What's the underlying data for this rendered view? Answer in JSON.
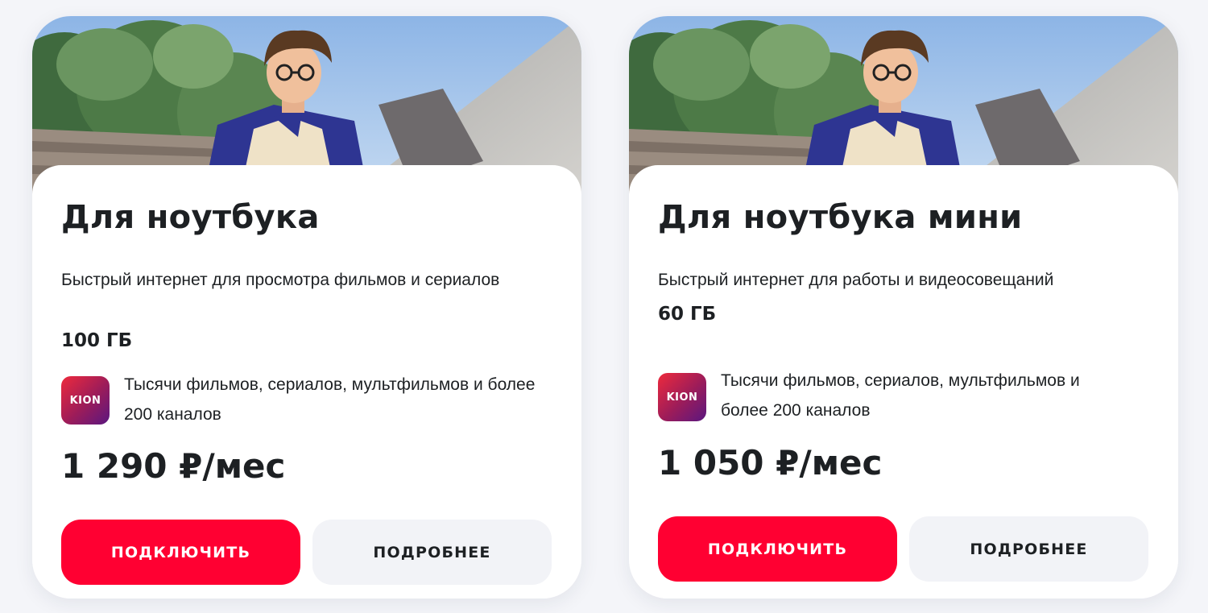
{
  "cards": [
    {
      "title": "Для ноутбука",
      "description": "Быстрый интернет для просмотра фильмов и сериалов",
      "data_amount": "100 ГБ",
      "kion_logo": "KION",
      "kion_text": "Тысячи фильмов, сериалов, мультфильмов и более 200 каналов",
      "price": "1 290 ₽/мес",
      "connect_label": "ПОДКЛЮЧИТЬ",
      "details_label": "ПОДРОБНЕЕ"
    },
    {
      "title": "Для ноутбука мини",
      "description": "Быстрый интернет для работы и видеосовещаний",
      "data_amount": "60 ГБ",
      "kion_logo": "KION",
      "kion_text": "Тысячи фильмов, сериалов, мультфильмов и более 200 каналов",
      "price": "1 050 ₽/мес",
      "connect_label": "ПОДКЛЮЧИТЬ",
      "details_label": "ПОДРОБНЕЕ"
    }
  ],
  "colors": {
    "accent_red": "#ff0032",
    "secondary_button": "#f2f3f7",
    "text": "#1d2023",
    "kion_gradient_start": "#ee2a3c",
    "kion_gradient_end": "#5a1780"
  },
  "icons": [
    "kion-logo-icon"
  ]
}
